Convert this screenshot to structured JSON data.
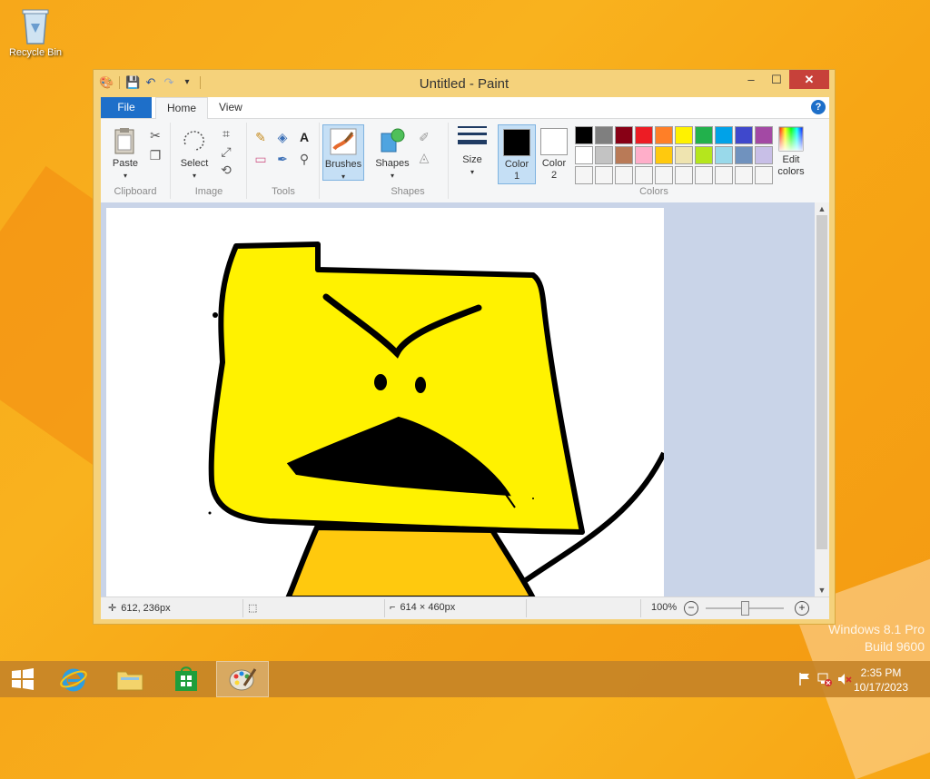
{
  "desktop": {
    "recycle_bin_label": "Recycle Bin",
    "watermark_line1": "Windows 8.1 Pro",
    "watermark_line2": "Build 9600"
  },
  "window": {
    "title": "Untitled - Paint",
    "tabs": {
      "file": "File",
      "home": "Home",
      "view": "View"
    }
  },
  "ribbon": {
    "clipboard": {
      "label": "Clipboard",
      "paste": "Paste"
    },
    "image": {
      "label": "Image",
      "select": "Select"
    },
    "tools": {
      "label": "Tools"
    },
    "brushes": {
      "label": "Brushes"
    },
    "shapes": {
      "label": "Shapes",
      "shapes_btn": "Shapes"
    },
    "size": {
      "label": "Size"
    },
    "colors": {
      "label": "Colors",
      "color1": "Color",
      "color1_num": "1",
      "color2": "Color",
      "color2_num": "2",
      "edit_colors_line1": "Edit",
      "edit_colors_line2": "colors",
      "color1_value": "#000000",
      "color2_value": "#ffffff",
      "palette": [
        "#000000",
        "#7f7f7f",
        "#880015",
        "#ed1c24",
        "#ff7f27",
        "#fff200",
        "#22b14c",
        "#00a2e8",
        "#3f48cc",
        "#a349a4",
        "#ffffff",
        "#c3c3c3",
        "#b97a57",
        "#ffaec9",
        "#ffc90e",
        "#efe4b0",
        "#b5e61d",
        "#99d9ea",
        "#7092be",
        "#c8bfe7",
        "#f5f5f5",
        "#f5f5f5",
        "#f5f5f5",
        "#f5f5f5",
        "#f5f5f5",
        "#f5f5f5",
        "#f5f5f5",
        "#f5f5f5",
        "#f5f5f5",
        "#f5f5f5"
      ]
    }
  },
  "status": {
    "cursor_pos": "612, 236px",
    "image_size": "614 × 460px",
    "zoom": "100%"
  },
  "taskbar": {
    "time": "2:35 PM",
    "date": "10/17/2023"
  }
}
